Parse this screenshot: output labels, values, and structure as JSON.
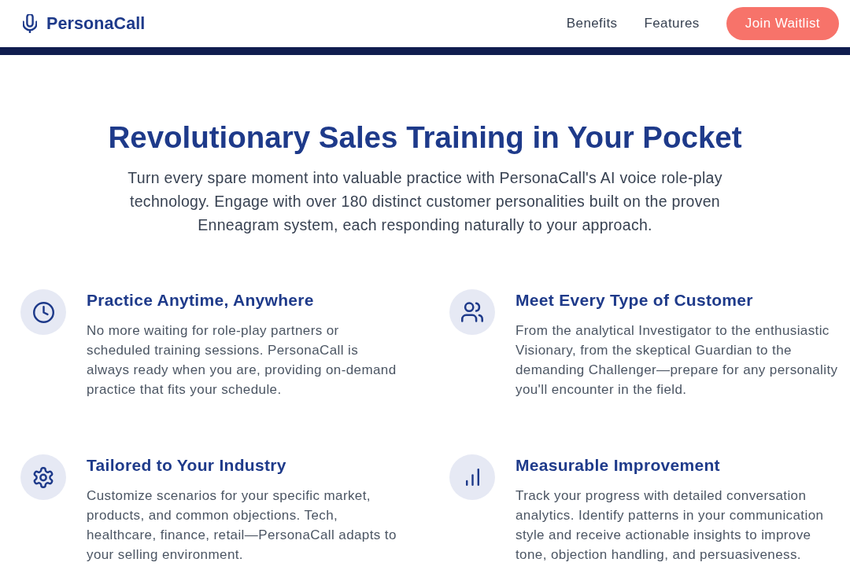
{
  "header": {
    "logo": "PersonaCall",
    "nav": [
      {
        "label": "Benefits"
      },
      {
        "label": "Features"
      }
    ],
    "cta": "Join Waitlist"
  },
  "hero": {
    "title": "Revolutionary Sales Training in Your Pocket",
    "description": "Turn every spare moment into valuable practice with PersonaCall's AI voice role-play technology. Engage with over 180 distinct customer personalities built on the proven Enneagram system, each responding naturally to your approach."
  },
  "features": [
    {
      "kind": "schedule",
      "title": "Practice Anytime, Anywhere",
      "description": "No more waiting for role-play partners or scheduled training sessions. PersonaCall is always ready when you are, providing on-demand practice that fits your schedule."
    },
    {
      "kind": "personas",
      "title": "Meet Every Type of Customer",
      "description": "From the analytical Investigator to the enthusiastic Visionary, from the skeptical Guardian to the demanding Challenger—prepare for any personality you'll encounter in the field."
    },
    {
      "kind": "customization",
      "title": "Tailored to Your Industry",
      "description": "Customize scenarios for your specific market, products, and common objections. Tech, healthcare, finance, retail—PersonaCall adapts to your selling environment."
    },
    {
      "kind": "analytics",
      "title": "Measurable Improvement",
      "description": "Track your progress with detailed conversation analytics. Identify patterns in your communication style and receive actionable insights to improve tone, objection handling, and persuasiveness."
    }
  ]
}
